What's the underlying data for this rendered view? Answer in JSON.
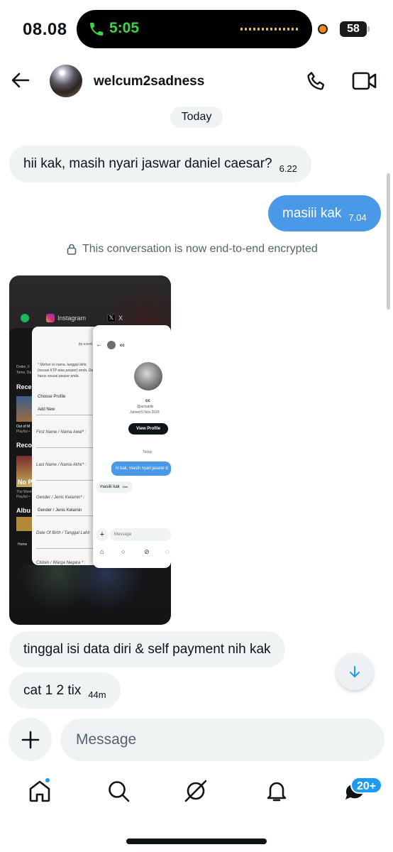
{
  "status_bar": {
    "time": "08.08",
    "call_time": "5:05",
    "battery": "58"
  },
  "header": {
    "contact_name": "welcum2sadness",
    "back_icon": "arrow-left-icon",
    "call_icon": "phone-icon",
    "video_icon": "video-camera-icon"
  },
  "conversation": {
    "date_label": "Today",
    "messages": [
      {
        "direction": "in",
        "text": "hii kak, masih nyari jaswar daniel caesar?",
        "time": "6.22"
      },
      {
        "direction": "out",
        "text": "masiii kak",
        "time": "7.04"
      },
      {
        "direction": "in",
        "text": "tinggal isi data diri & self payment nih kak",
        "time": ""
      },
      {
        "direction": "in",
        "text": "cat 1 2 tix",
        "time": "44m"
      }
    ],
    "encryption_note": "This conversation is now end-to-end encrypted"
  },
  "attachment": {
    "app_labels": [
      "Instagram",
      "X"
    ],
    "spotify_lines": [
      "Drake, F",
      "Tems, Da",
      "Recen",
      "Out of M",
      "Playlist •",
      "Reco",
      "No P",
      "The Week",
      "Playlist •",
      "Albu",
      "Home"
    ],
    "form": {
      "url": "jtp.event",
      "intro": "* Mohon isi nama, tanggal lahir, (sesuai KTP atau paspor) anda. Data harus sesuai paspor anda.",
      "choose_profile": "Choose Profile",
      "add_new": "Add New",
      "first_name": "First Name / Nama Awal* :",
      "last_name": "Last Name / Nama Akhir* :",
      "gender": "Gender / Jenis Kelamin* :",
      "gender_value": "Gender / Jenis Kelamin",
      "dob": "Date Of Birth / Tanggal Lahir",
      "citizen": "Citizen / Warga Negara * :"
    },
    "x_chat": {
      "name": "cc",
      "handle": "@achabils",
      "joined": "Joined 5 Nov 2018",
      "view_profile": "View Profile",
      "date": "Today",
      "out_message": "hi kak, masih nyari jaswar d",
      "in_message": "masiiii kak",
      "in_time": "18m",
      "input_placeholder": "Message"
    }
  },
  "composer": {
    "placeholder": "Message",
    "value": ""
  },
  "bottom_nav": {
    "items": [
      "home-icon",
      "search-icon",
      "grok-icon",
      "bell-icon",
      "messages-icon"
    ],
    "messages_badge": "20+"
  }
}
